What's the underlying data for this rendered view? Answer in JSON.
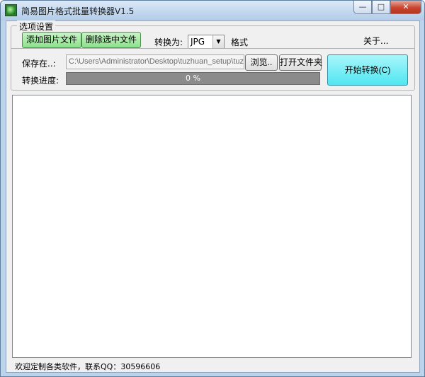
{
  "window": {
    "title": "简易图片格式批量转换器V1.5",
    "min_glyph": "—",
    "max_glyph": "□",
    "close_glyph": "✕"
  },
  "options": {
    "group_title": "选项设置",
    "add_files_label": "添加图片文件",
    "delete_selected_label": "删除选中文件",
    "convert_to_label": "转换为:",
    "format_selected": "JPG",
    "format_suffix": "格式",
    "about_label": "关于...",
    "save_to_label": "保存在..:",
    "save_path": "C:\\Users\\Administrator\\Desktop\\tuzhuan_setup\\tuzhu",
    "browse_label": "浏览..",
    "open_folder_label": "打开文件夹",
    "start_label": "开始转换(C)",
    "progress_label": "转换进度:",
    "progress_percent": 0,
    "progress_text": "0 %"
  },
  "status": {
    "text": "欢迎定制各类软件，联系QQ：30596606"
  },
  "colors": {
    "accent_green": "#8be28b",
    "accent_cyan": "#50e6f1",
    "progress_track": "#8b8b8b"
  },
  "icons": {
    "app": "app-icon",
    "dropdown": "chevron-down-icon"
  }
}
